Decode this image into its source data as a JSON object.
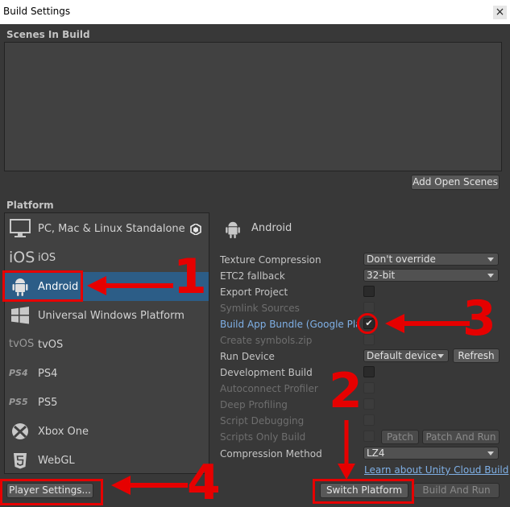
{
  "window": {
    "title": "Build Settings",
    "close_glyph": "×"
  },
  "scenes": {
    "label": "Scenes In Build",
    "add_open_scenes": "Add Open Scenes"
  },
  "platform": {
    "label": "Platform",
    "items": [
      {
        "label": "PC, Mac & Linux Standalone",
        "icon": "monitor-icon"
      },
      {
        "label": "iOS",
        "icon": "ios-icon",
        "icon_text": "iOS"
      },
      {
        "label": "Android",
        "icon": "android-icon",
        "selected": true
      },
      {
        "label": "Universal Windows Platform",
        "icon": "windows-icon"
      },
      {
        "label": "tvOS",
        "icon": "tvos-icon",
        "icon_text": "tvOS"
      },
      {
        "label": "PS4",
        "icon": "ps4-icon",
        "icon_text": "PS4"
      },
      {
        "label": "PS5",
        "icon": "ps5-icon",
        "icon_text": "PS5"
      },
      {
        "label": "Xbox One",
        "icon": "xbox-icon"
      },
      {
        "label": "WebGL",
        "icon": "html5-icon"
      }
    ]
  },
  "android": {
    "title": "Android",
    "texture_compression": {
      "label": "Texture Compression",
      "value": "Don't override"
    },
    "etc2_fallback": {
      "label": "ETC2 fallback",
      "value": "32-bit"
    },
    "export_project": "Export Project",
    "symlink_sources": "Symlink Sources",
    "build_app_bundle": "Build App Bundle (Google Play)",
    "create_symbols": "Create symbols.zip",
    "run_device": {
      "label": "Run Device",
      "value": "Default device",
      "refresh": "Refresh"
    },
    "development_build": "Development Build",
    "autoconnect_profiler": "Autoconnect Profiler",
    "deep_profiling": "Deep Profiling",
    "script_debugging": "Script Debugging",
    "scripts_only_build": "Scripts Only Build",
    "patch": "Patch",
    "patch_and_run": "Patch And Run",
    "compression_method": {
      "label": "Compression Method",
      "value": "LZ4"
    },
    "cloud_build_link": "Learn about Unity Cloud Build"
  },
  "footer": {
    "player_settings": "Player Settings...",
    "switch_platform": "Switch Platform",
    "build_and_run": "Build And Run"
  },
  "annotations": {
    "n1": "1",
    "n2": "2",
    "n3": "3",
    "n4": "4",
    "color": "#e60000"
  },
  "colors": {
    "background": "#383838",
    "selected": "#2c5d87",
    "link": "#7fb0e6"
  }
}
